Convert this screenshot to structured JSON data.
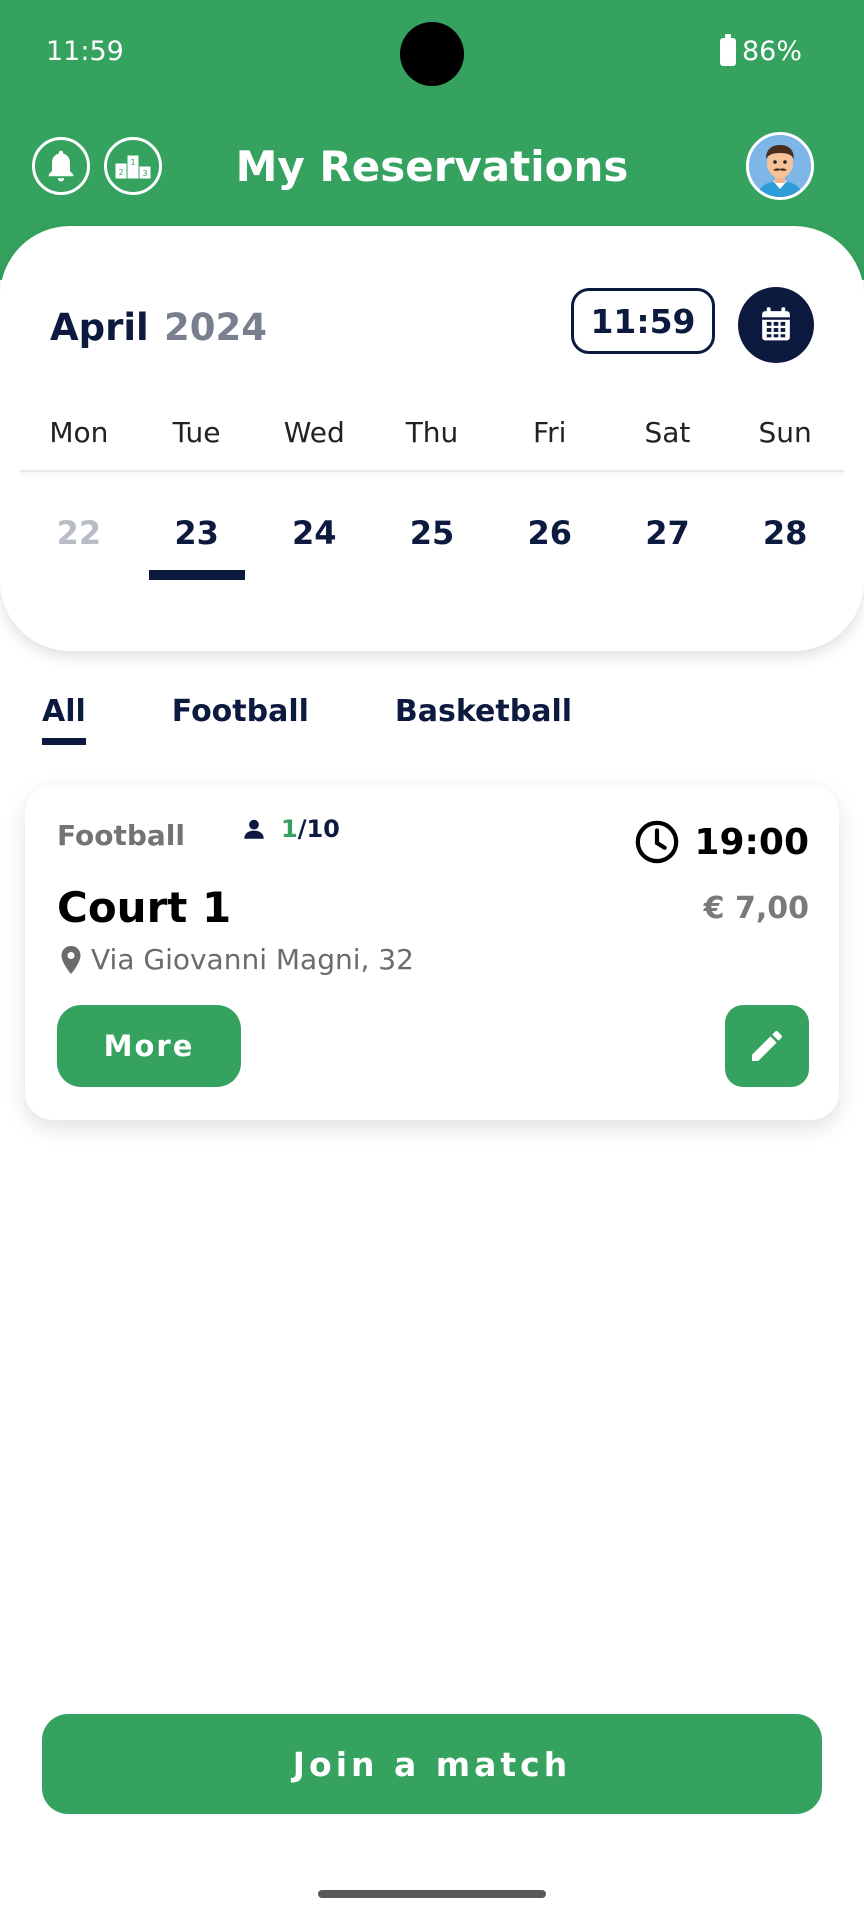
{
  "status_bar": {
    "time": "11:59",
    "battery": "86%"
  },
  "header": {
    "title": "My Reservations"
  },
  "calendar": {
    "month": "April",
    "year": "2024",
    "current_time": "11:59",
    "weekdays": [
      "Mon",
      "Tue",
      "Wed",
      "Thu",
      "Fri",
      "Sat",
      "Sun"
    ],
    "days": [
      "22",
      "23",
      "24",
      "25",
      "26",
      "27",
      "28"
    ]
  },
  "tabs": [
    "All",
    "Football",
    "Basketball"
  ],
  "reservation": {
    "sport": "Football",
    "players_current": "1",
    "players_max": "/10",
    "time": "19:00",
    "court": "Court 1",
    "price": "€ 7,00",
    "address": "Via Giovanni Magni, 32",
    "more_label": "More"
  },
  "join_label": "Join a match",
  "colors": {
    "primary": "#35a25f",
    "navy": "#0d1a3f",
    "muted": "#7a7f90"
  },
  "icons": [
    "bell-icon",
    "podium-icon",
    "avatar-icon",
    "calendar-icon",
    "person-icon",
    "clock-icon",
    "location-pin-icon",
    "pencil-icon"
  ]
}
